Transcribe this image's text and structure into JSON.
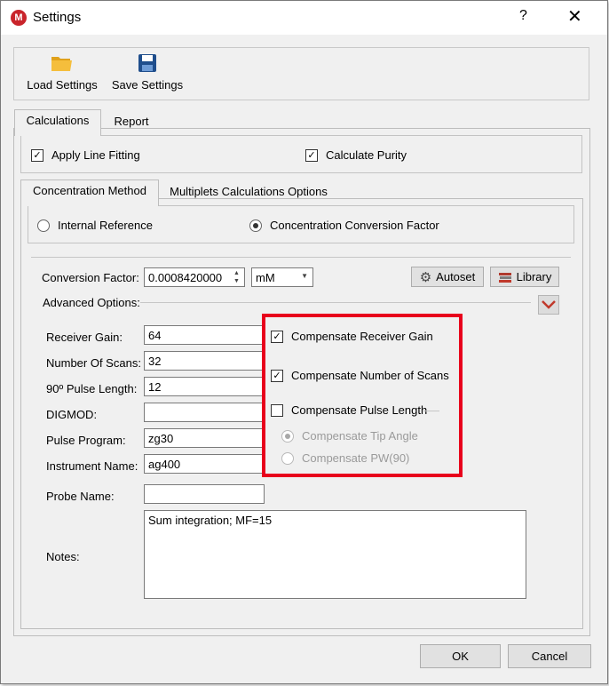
{
  "window": {
    "title": "Settings",
    "help_glyph": "?",
    "close_glyph": "✕",
    "app_icon_letter": "M"
  },
  "toolbar": {
    "load_label": "Load Settings",
    "save_label": "Save Settings"
  },
  "tabs": {
    "calculations": "Calculations",
    "report": "Report"
  },
  "calc": {
    "apply_line_fitting": "Apply Line Fitting",
    "calculate_purity": "Calculate Purity"
  },
  "subtabs": {
    "concentration_method": "Concentration Method",
    "multiplets": "Multiplets Calculations Options"
  },
  "method": {
    "internal_reference": "Internal Reference",
    "conversion_factor_option": "Concentration Conversion Factor"
  },
  "conversion": {
    "label": "Conversion Factor:",
    "value": "0.0008420000",
    "unit": "mM",
    "autoset": "Autoset",
    "library": "Library"
  },
  "advanced": {
    "label": "Advanced Options:"
  },
  "fields": {
    "receiver_gain": {
      "label": "Receiver Gain:",
      "value": "64"
    },
    "number_of_scans": {
      "label": "Number Of Scans:",
      "value": "32"
    },
    "pulse_length": {
      "label": "90º Pulse Length:",
      "value": "12"
    },
    "digmod": {
      "label": "DIGMOD:",
      "value": ""
    },
    "pulse_program": {
      "label": "Pulse Program:",
      "value": "zg30"
    },
    "instrument_name": {
      "label": "Instrument Name:",
      "value": "ag400"
    },
    "probe_name": {
      "label": "Probe Name:",
      "value": ""
    },
    "notes": {
      "label": "Notes:",
      "value": "Sum integration; MF=15"
    }
  },
  "compensate": {
    "receiver_gain": "Compensate Receiver Gain",
    "number_of_scans": "Compensate Number of Scans",
    "pulse_length": "Compensate Pulse Length",
    "tip_angle": "Compensate Tip Angle",
    "pw90": "Compensate PW(90)"
  },
  "footer": {
    "ok": "OK",
    "cancel": "Cancel"
  },
  "colors": {
    "highlight": "#e8001c",
    "app_icon": "#c9242b",
    "expand_arrow": "#c0392b"
  }
}
